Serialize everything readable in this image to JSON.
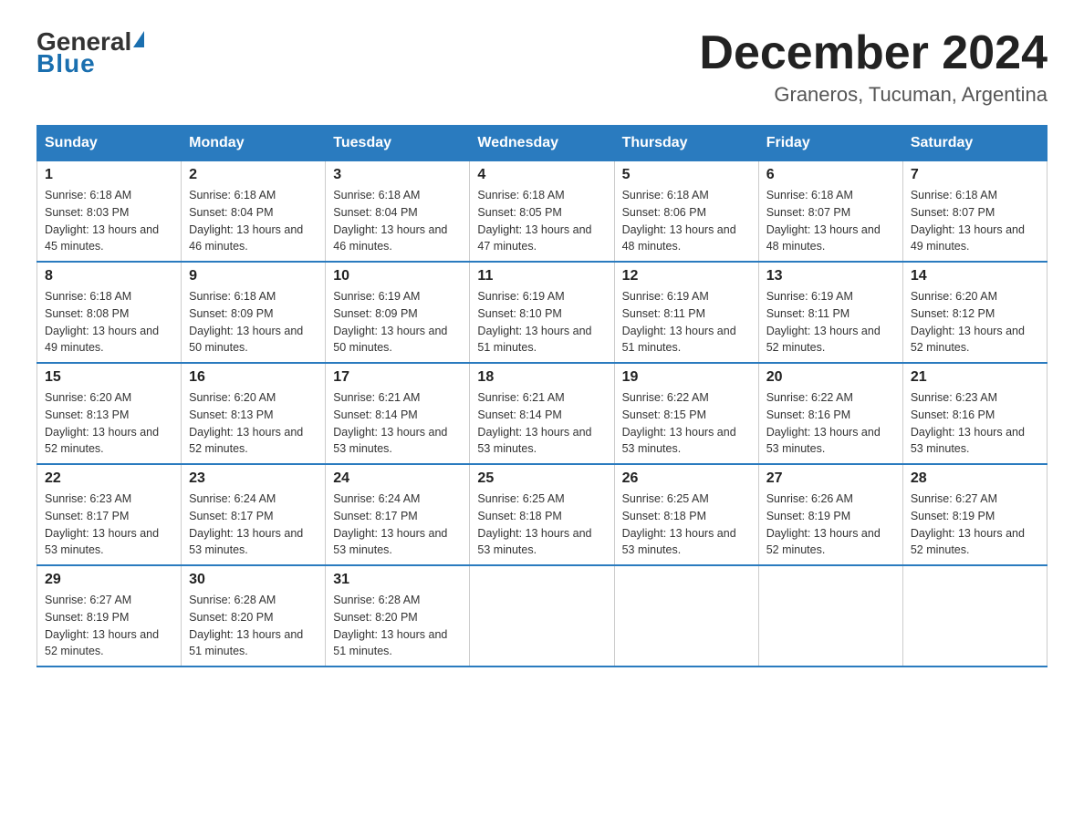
{
  "logo": {
    "general": "General",
    "triangle": "",
    "blue": "Blue"
  },
  "title": {
    "month": "December 2024",
    "location": "Graneros, Tucuman, Argentina"
  },
  "headers": [
    "Sunday",
    "Monday",
    "Tuesday",
    "Wednesday",
    "Thursday",
    "Friday",
    "Saturday"
  ],
  "weeks": [
    [
      {
        "day": "1",
        "sunrise": "6:18 AM",
        "sunset": "8:03 PM",
        "daylight": "13 hours and 45 minutes."
      },
      {
        "day": "2",
        "sunrise": "6:18 AM",
        "sunset": "8:04 PM",
        "daylight": "13 hours and 46 minutes."
      },
      {
        "day": "3",
        "sunrise": "6:18 AM",
        "sunset": "8:04 PM",
        "daylight": "13 hours and 46 minutes."
      },
      {
        "day": "4",
        "sunrise": "6:18 AM",
        "sunset": "8:05 PM",
        "daylight": "13 hours and 47 minutes."
      },
      {
        "day": "5",
        "sunrise": "6:18 AM",
        "sunset": "8:06 PM",
        "daylight": "13 hours and 48 minutes."
      },
      {
        "day": "6",
        "sunrise": "6:18 AM",
        "sunset": "8:07 PM",
        "daylight": "13 hours and 48 minutes."
      },
      {
        "day": "7",
        "sunrise": "6:18 AM",
        "sunset": "8:07 PM",
        "daylight": "13 hours and 49 minutes."
      }
    ],
    [
      {
        "day": "8",
        "sunrise": "6:18 AM",
        "sunset": "8:08 PM",
        "daylight": "13 hours and 49 minutes."
      },
      {
        "day": "9",
        "sunrise": "6:18 AM",
        "sunset": "8:09 PM",
        "daylight": "13 hours and 50 minutes."
      },
      {
        "day": "10",
        "sunrise": "6:19 AM",
        "sunset": "8:09 PM",
        "daylight": "13 hours and 50 minutes."
      },
      {
        "day": "11",
        "sunrise": "6:19 AM",
        "sunset": "8:10 PM",
        "daylight": "13 hours and 51 minutes."
      },
      {
        "day": "12",
        "sunrise": "6:19 AM",
        "sunset": "8:11 PM",
        "daylight": "13 hours and 51 minutes."
      },
      {
        "day": "13",
        "sunrise": "6:19 AM",
        "sunset": "8:11 PM",
        "daylight": "13 hours and 52 minutes."
      },
      {
        "day": "14",
        "sunrise": "6:20 AM",
        "sunset": "8:12 PM",
        "daylight": "13 hours and 52 minutes."
      }
    ],
    [
      {
        "day": "15",
        "sunrise": "6:20 AM",
        "sunset": "8:13 PM",
        "daylight": "13 hours and 52 minutes."
      },
      {
        "day": "16",
        "sunrise": "6:20 AM",
        "sunset": "8:13 PM",
        "daylight": "13 hours and 52 minutes."
      },
      {
        "day": "17",
        "sunrise": "6:21 AM",
        "sunset": "8:14 PM",
        "daylight": "13 hours and 53 minutes."
      },
      {
        "day": "18",
        "sunrise": "6:21 AM",
        "sunset": "8:14 PM",
        "daylight": "13 hours and 53 minutes."
      },
      {
        "day": "19",
        "sunrise": "6:22 AM",
        "sunset": "8:15 PM",
        "daylight": "13 hours and 53 minutes."
      },
      {
        "day": "20",
        "sunrise": "6:22 AM",
        "sunset": "8:16 PM",
        "daylight": "13 hours and 53 minutes."
      },
      {
        "day": "21",
        "sunrise": "6:23 AM",
        "sunset": "8:16 PM",
        "daylight": "13 hours and 53 minutes."
      }
    ],
    [
      {
        "day": "22",
        "sunrise": "6:23 AM",
        "sunset": "8:17 PM",
        "daylight": "13 hours and 53 minutes."
      },
      {
        "day": "23",
        "sunrise": "6:24 AM",
        "sunset": "8:17 PM",
        "daylight": "13 hours and 53 minutes."
      },
      {
        "day": "24",
        "sunrise": "6:24 AM",
        "sunset": "8:17 PM",
        "daylight": "13 hours and 53 minutes."
      },
      {
        "day": "25",
        "sunrise": "6:25 AM",
        "sunset": "8:18 PM",
        "daylight": "13 hours and 53 minutes."
      },
      {
        "day": "26",
        "sunrise": "6:25 AM",
        "sunset": "8:18 PM",
        "daylight": "13 hours and 53 minutes."
      },
      {
        "day": "27",
        "sunrise": "6:26 AM",
        "sunset": "8:19 PM",
        "daylight": "13 hours and 52 minutes."
      },
      {
        "day": "28",
        "sunrise": "6:27 AM",
        "sunset": "8:19 PM",
        "daylight": "13 hours and 52 minutes."
      }
    ],
    [
      {
        "day": "29",
        "sunrise": "6:27 AM",
        "sunset": "8:19 PM",
        "daylight": "13 hours and 52 minutes."
      },
      {
        "day": "30",
        "sunrise": "6:28 AM",
        "sunset": "8:20 PM",
        "daylight": "13 hours and 51 minutes."
      },
      {
        "day": "31",
        "sunrise": "6:28 AM",
        "sunset": "8:20 PM",
        "daylight": "13 hours and 51 minutes."
      },
      null,
      null,
      null,
      null
    ]
  ]
}
